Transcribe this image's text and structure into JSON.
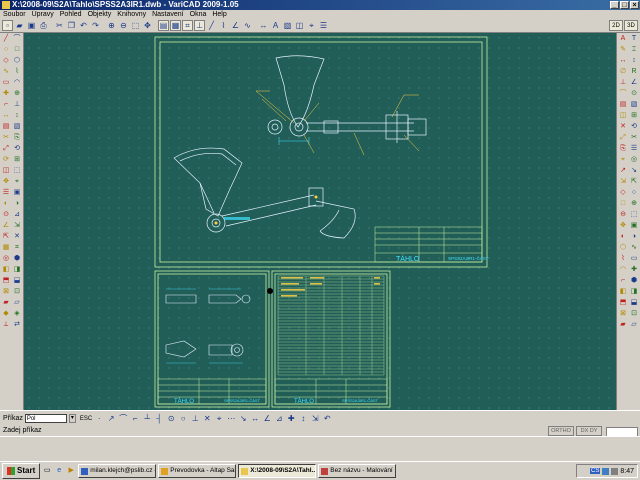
{
  "window": {
    "title": "X:\\2008-09\\S2A\\Tahlo\\SPSS2A3IR1.dwb - VariCAD 2009-1.05",
    "controls": [
      "_",
      "□",
      "×"
    ]
  },
  "menu": [
    "Soubor",
    "Úpravy",
    "Pohled",
    "Objekty",
    "Knihovny",
    "Nastavení",
    "Okna",
    "Help"
  ],
  "toolbar": {
    "view_2d": "2D",
    "view_3d": "3D"
  },
  "drawing": {
    "title_block_name": "TÁHLO",
    "part_number": "SPSS2A3IR1-ČÁST"
  },
  "command": {
    "label": "Příkaz",
    "value": "Pol",
    "esc": "ESC"
  },
  "status": {
    "prompt": "Zadej příkaz",
    "ortho": "ORTHO",
    "coords": "DX DY"
  },
  "taskbar": {
    "start": "Start",
    "tasks": [
      {
        "label": "milan.klejch@pslib.cz - 3...",
        "active": false
      },
      {
        "label": "Prevodovka - Altap Sala...",
        "active": false
      },
      {
        "label": "X:\\2008-09\\S2A\\Tahl...",
        "active": true
      },
      {
        "label": "Bez názvu - Malování",
        "active": false
      }
    ],
    "clock": "8:47",
    "lang": "CS"
  },
  "colors": {
    "canvas": "#215e58",
    "frame": "#c8f0a0",
    "model": "#e6f2ff",
    "dims": "#40e0ff",
    "labels": "#ffd040"
  }
}
